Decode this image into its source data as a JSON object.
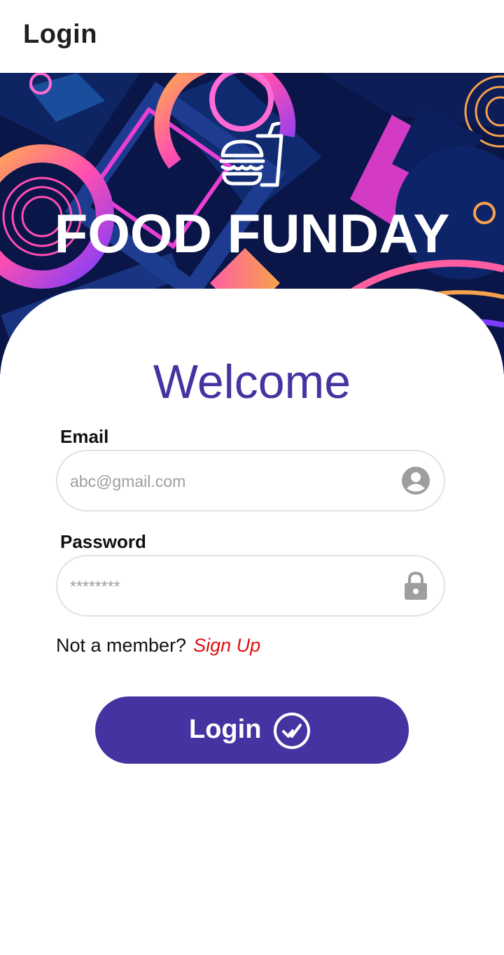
{
  "appbar": {
    "title": "Login"
  },
  "hero": {
    "brand": "FOOD FUNDAY",
    "logo_icon": "burger-drink-icon",
    "colors": {
      "navy": "#0a1548",
      "blue": "#1d3c8f",
      "magenta": "#e93fd3",
      "orange": "#f7a24a",
      "pink": "#ff5fa2"
    }
  },
  "form": {
    "welcome": "Welcome",
    "email": {
      "label": "Email",
      "placeholder": "abc@gmail.com",
      "value": "",
      "icon": "account-circle-icon"
    },
    "password": {
      "label": "Password",
      "placeholder": "********",
      "value": "",
      "icon": "lock-icon"
    },
    "member_prompt": "Not a member?",
    "signup_link": "Sign Up",
    "login_button": {
      "label": "Login",
      "icon": "check-circle-icon"
    }
  },
  "colors": {
    "primary": "#4433a0",
    "link": "#e01010",
    "field_border": "#e1e1e1",
    "icon_gray": "#9e9e9e"
  }
}
